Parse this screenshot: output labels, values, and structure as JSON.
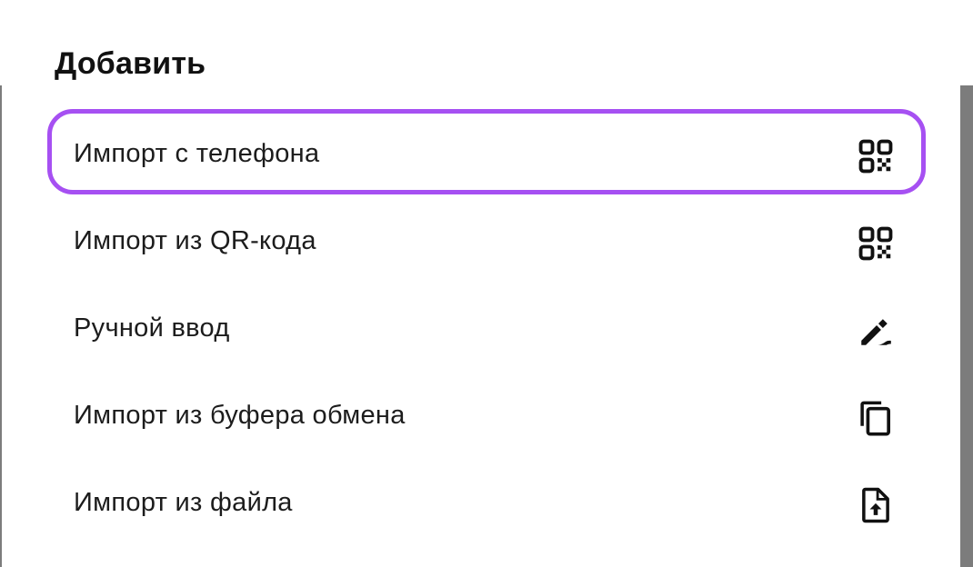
{
  "dialog": {
    "title": "Добавить",
    "items": [
      {
        "label": "Импорт с телефона",
        "icon": "qr-code-icon",
        "focused": true
      },
      {
        "label": "Импорт из QR-кода",
        "icon": "qr-code-icon",
        "focused": false
      },
      {
        "label": "Ручной ввод",
        "icon": "edit-pencil-icon",
        "focused": false
      },
      {
        "label": "Импорт из буфера обмена",
        "icon": "copy-icon",
        "focused": false
      },
      {
        "label": "Импорт из файла",
        "icon": "file-upload-icon",
        "focused": false
      }
    ]
  },
  "colors": {
    "focus_ring": "#a650f2",
    "text": "#1c1c1c",
    "sheet_background": "#ffffff",
    "scrim": "#7c7c7c"
  }
}
